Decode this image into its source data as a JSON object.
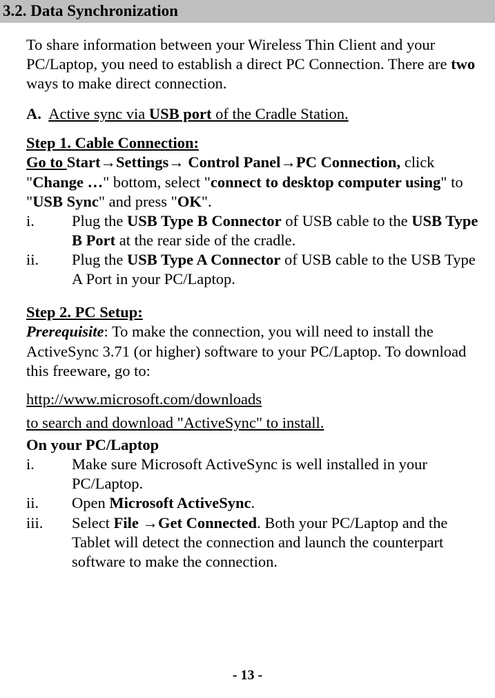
{
  "heading": "3.2. Data Synchronization",
  "intro_pre": "To share information between your Wireless Thin Client and your PC/Laptop, you need to establish a direct PC Connection. There are ",
  "intro_bold": "two",
  "intro_post": " ways to make direct connection.",
  "A": {
    "marker": "A.",
    "text_pre": "Active sync via ",
    "usb_port": "USB port",
    "text_post": " of the Cradle Station."
  },
  "step1": {
    "title": "Step 1. Cable Connection:",
    "line_go_to": "Go to ",
    "line_path": "Start→Settings→ Control Panel→PC Connection, ",
    "line_click": "click \"",
    "change": "Change …",
    "line_bottom_select": "\" bottom, select \"",
    "connect_using": "connect to desktop computer using",
    "line_to": "\" to \"",
    "usb_sync": "USB Sync",
    "line_and_press": "\" and  press \"",
    "ok": "OK",
    "line_end": "\".",
    "items": [
      {
        "marker": "i.",
        "pre": "Plug the ",
        "b1": "USB Type B Connector",
        "mid": " of USB cable to the ",
        "b2": "USB Type B Port",
        "post": " at the rear side of the cradle."
      },
      {
        "marker": "ii.",
        "pre": "Plug the ",
        "b1": "USB Type A Connector",
        "mid": " of USB cable to the USB Type A Port in your PC/Laptop.",
        "b2": "",
        "post": ""
      }
    ]
  },
  "step2": {
    "title": "Step 2. PC Setup:",
    "prereq_label": "Prerequisite",
    "prereq_text": ": To make the connection, you will need to install the ActiveSync 3.71 (or higher) software to your PC/Laptop. To download this freeware, go to:",
    "url": " http://www.microsoft.com/downloads",
    "search_line": "to search and download \"ActiveSync\" to install.",
    "on_pc": "On your PC/Laptop",
    "items": [
      {
        "marker": "i.",
        "text": "Make sure Microsoft ActiveSync is well installed in your PC/Laptop."
      },
      {
        "marker": "ii.",
        "pre": "Open ",
        "b1": "Microsoft ActiveSync",
        "post": "."
      },
      {
        "marker": "iii.",
        "pre": "Select ",
        "b1": "File →Get Connected",
        "post": ". Both your PC/Laptop and the Tablet will detect the connection and launch the counterpart software to make the connection."
      }
    ]
  },
  "page_number": "- 13 -"
}
